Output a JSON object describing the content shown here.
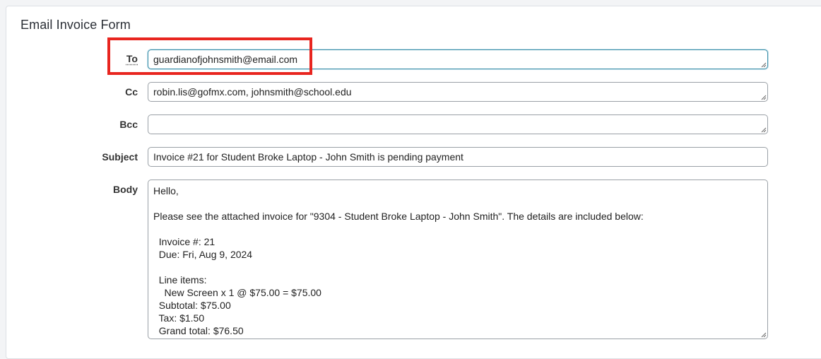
{
  "form": {
    "title": "Email Invoice Form"
  },
  "fields": {
    "to": {
      "label": "To",
      "value": "guardianofjohnsmith@email.com"
    },
    "cc": {
      "label": "Cc",
      "value": "robin.lis@gofmx.com, johnsmith@school.edu"
    },
    "bcc": {
      "label": "Bcc",
      "value": ""
    },
    "subject": {
      "label": "Subject",
      "value": "Invoice #21 for Student Broke Laptop - John Smith is pending payment"
    },
    "body": {
      "label": "Body",
      "lines": [
        "Hello,",
        "",
        "Please see the attached invoice for \"9304 - Student Broke Laptop - John Smith\". The details are included below:",
        "",
        "  Invoice #: 21",
        "  Due: Fri, Aug 9, 2024",
        "",
        "  Line items:",
        "    New Screen x 1 @ $75.00 = $75.00",
        "  Subtotal: $75.00",
        "  Tax: $1.50",
        "  Grand total: $76.50"
      ]
    }
  },
  "colors": {
    "highlight": "#e8251f",
    "focus_border": "#3a8ea8"
  }
}
